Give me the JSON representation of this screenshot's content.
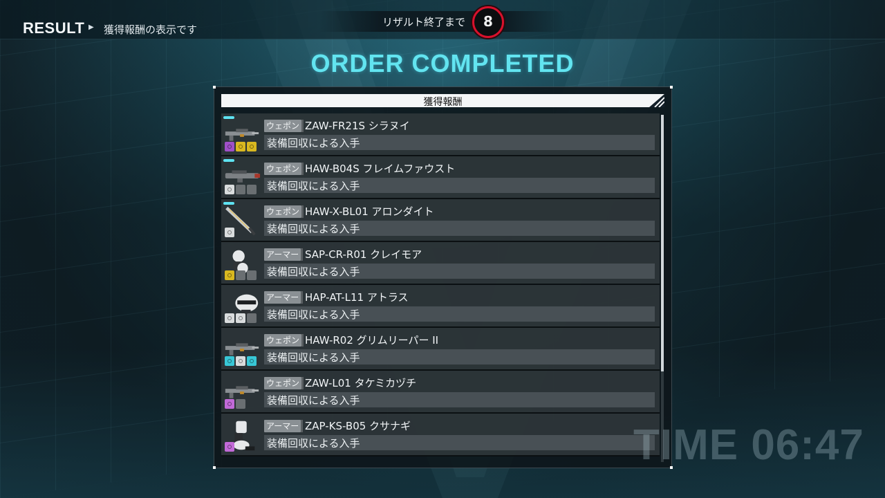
{
  "header": {
    "result_label": "RESULT",
    "subtitle": "獲得報酬の表示です",
    "countdown_label": "リザルト終了まで",
    "countdown_value": "8"
  },
  "main": {
    "title": "ORDER COMPLETED",
    "panel_title": "獲得報酬",
    "scroll_visible_fraction": 0.74,
    "items": [
      {
        "category": "ウェポン",
        "name": "ZAW-FR21S シラヌイ",
        "acquisition": "装備回収による入手",
        "is_new": true,
        "icon": "rifle-icon",
        "badges": [
          "purple",
          "yellow",
          "yellow"
        ]
      },
      {
        "category": "ウェポン",
        "name": "HAW-B04S フレイムファウスト",
        "acquisition": "装備回収による入手",
        "is_new": true,
        "icon": "cannon-icon",
        "badges": [
          "white",
          "gray",
          "gray"
        ]
      },
      {
        "category": "ウェポン",
        "name": "HAW-X-BL01 アロンダイト",
        "acquisition": "装備回収による入手",
        "is_new": true,
        "icon": "sword-icon",
        "badges": [
          "white"
        ]
      },
      {
        "category": "アーマー",
        "name": "SAP-CR-R01 クレイモア",
        "acquisition": "装備回収による入手",
        "is_new": false,
        "icon": "arm-armor-icon",
        "badges": [
          "yellow",
          "gray",
          "gray"
        ]
      },
      {
        "category": "アーマー",
        "name": "HAP-AT-L11 アトラス",
        "acquisition": "装備回収による入手",
        "is_new": false,
        "icon": "head-armor-icon",
        "badges": [
          "white",
          "white",
          "gray"
        ]
      },
      {
        "category": "ウェポン",
        "name": "HAW-R02 グリムリーパー II",
        "acquisition": "装備回収による入手",
        "is_new": false,
        "icon": "rifle-icon",
        "badges": [
          "cyan",
          "white",
          "cyan"
        ]
      },
      {
        "category": "ウェポン",
        "name": "ZAW-L01 タケミカヅチ",
        "acquisition": "装備回収による入手",
        "is_new": false,
        "icon": "rifle-icon",
        "badges": [
          "pink",
          "gray"
        ]
      },
      {
        "category": "アーマー",
        "name": "ZAP-KS-B05 クサナギ",
        "acquisition": "装備回収による入手",
        "is_new": false,
        "icon": "leg-armor-icon",
        "badges": [
          "pink"
        ]
      }
    ]
  },
  "footer": {
    "time_label": "TIME 06:47"
  },
  "colors": {
    "accent": "#62e4f0",
    "countdown_ring": "#d8112c",
    "new_marker": "#5ee3f2"
  }
}
